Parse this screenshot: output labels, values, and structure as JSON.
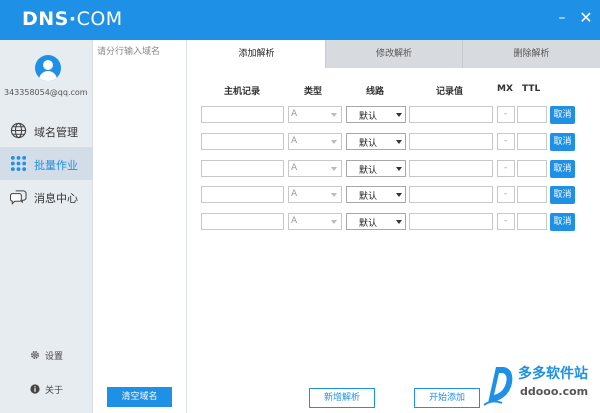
{
  "app": {
    "logo_main": "DNS",
    "logo_dot": "·",
    "logo_suffix": "COM",
    "accent": "#1e90e6"
  },
  "window": {
    "minimize": "–",
    "close": "✕"
  },
  "sidebar": {
    "email": "343358054@qq.com",
    "items": [
      {
        "label": "域名管理",
        "icon": "globe-icon"
      },
      {
        "label": "批量作业",
        "icon": "grid-dots-icon",
        "active": true
      },
      {
        "label": "消息中心",
        "icon": "chat-bubble-icon"
      }
    ],
    "settings_label": "设置",
    "about_label": "关于"
  },
  "domain_list": {
    "placeholder": "请分行输入域名",
    "clear_button": "清空域名"
  },
  "tabs": [
    {
      "label": "添加解析",
      "active": true
    },
    {
      "label": "修改解析"
    },
    {
      "label": "删除解析"
    }
  ],
  "table": {
    "headers": {
      "host": "主机记录",
      "type": "类型",
      "line": "线路",
      "value": "记录值",
      "mx": "MX",
      "ttl": "TTL"
    },
    "rows": [
      {
        "type": "A",
        "line": "默认",
        "mx": "-",
        "cancel": "取消"
      },
      {
        "type": "A",
        "line": "默认",
        "mx": "-",
        "cancel": "取消"
      },
      {
        "type": "A",
        "line": "默认",
        "mx": "-",
        "cancel": "取消"
      },
      {
        "type": "A",
        "line": "默认",
        "mx": "-",
        "cancel": "取消"
      },
      {
        "type": "A",
        "line": "默认",
        "mx": "-",
        "cancel": "取消"
      }
    ]
  },
  "actions": {
    "add_new": "新增解析",
    "start_add": "开始添加"
  },
  "watermark": {
    "title": "多多软件站",
    "url": "ddooo.com"
  }
}
